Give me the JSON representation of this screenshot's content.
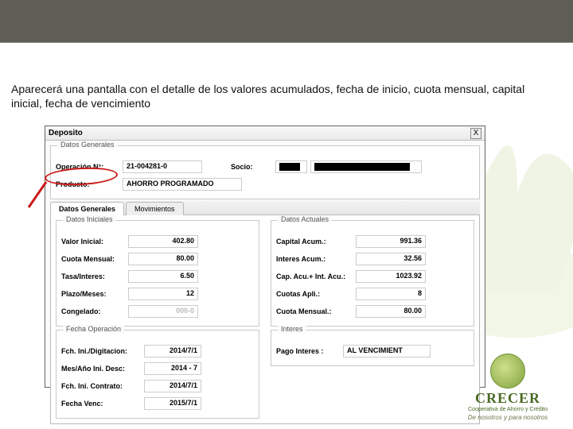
{
  "caption": "Aparecerá una pantalla con el detalle de los valores acumulados, fecha de inicio, cuota mensual, capital inicial, fecha de vencimiento",
  "window": {
    "title": "Deposito",
    "close": "X",
    "datos_generales": {
      "legend": "Datos Generales",
      "operacion_lbl": "Operación N°:",
      "operacion_val": "21-004281-0",
      "socio_lbl": "Socio:",
      "producto_lbl": "Producto:",
      "producto_val": "AHORRO PROGRAMADO"
    },
    "tabs": {
      "t1": "Datos Generales",
      "t2": "Movimientos"
    },
    "iniciales": {
      "legend": "Datos Iniciales",
      "valor_inicial_lbl": "Valor Inicial:",
      "valor_inicial_val": "402.80",
      "cuota_mensual_lbl": "Cuota Mensual:",
      "cuota_mensual_val": "80.00",
      "tasa_lbl": "Tasa/Interes:",
      "tasa_val": "6.50",
      "plazo_lbl": "Plazo/Meses:",
      "plazo_val": "12",
      "congelado_lbl": "Congelado:",
      "congelado_val": "000-0"
    },
    "actuales": {
      "legend": "Datos Actuales",
      "capital_lbl": "Capital Acum.:",
      "capital_val": "991.36",
      "interes_lbl": "Interes Acum.:",
      "interes_val": "32.56",
      "capint_lbl": "Cap. Acu.+ Int. Acu.:",
      "capint_val": "1023.92",
      "cuotas_lbl": "Cuotas Apli.:",
      "cuotas_val": "8",
      "cuota_mensual_lbl": "Cuota Mensual.:",
      "cuota_mensual_val": "80.00"
    },
    "fechas": {
      "legend": "Fecha Operación",
      "dig_lbl": "Fch. Ini./Digitacion:",
      "dig_val": "2014/7/1",
      "mes_lbl": "Mes/Año Ini. Desc:",
      "mes_val": "2014 - 7",
      "cont_lbl": "Fch. Ini. Contrato:",
      "cont_val": "2014/7/1",
      "venc_lbl": "Fecha Venc:",
      "venc_val": "2015/7/1"
    },
    "interes": {
      "legend": "Interes",
      "pago_lbl": "Pago Interes :",
      "pago_val": "AL VENCIMIENT"
    }
  },
  "logo": {
    "name": "CRECER",
    "sub": "Cooperativa de Ahorro y Crédito",
    "tag": "De nosotros y para nosotros"
  }
}
